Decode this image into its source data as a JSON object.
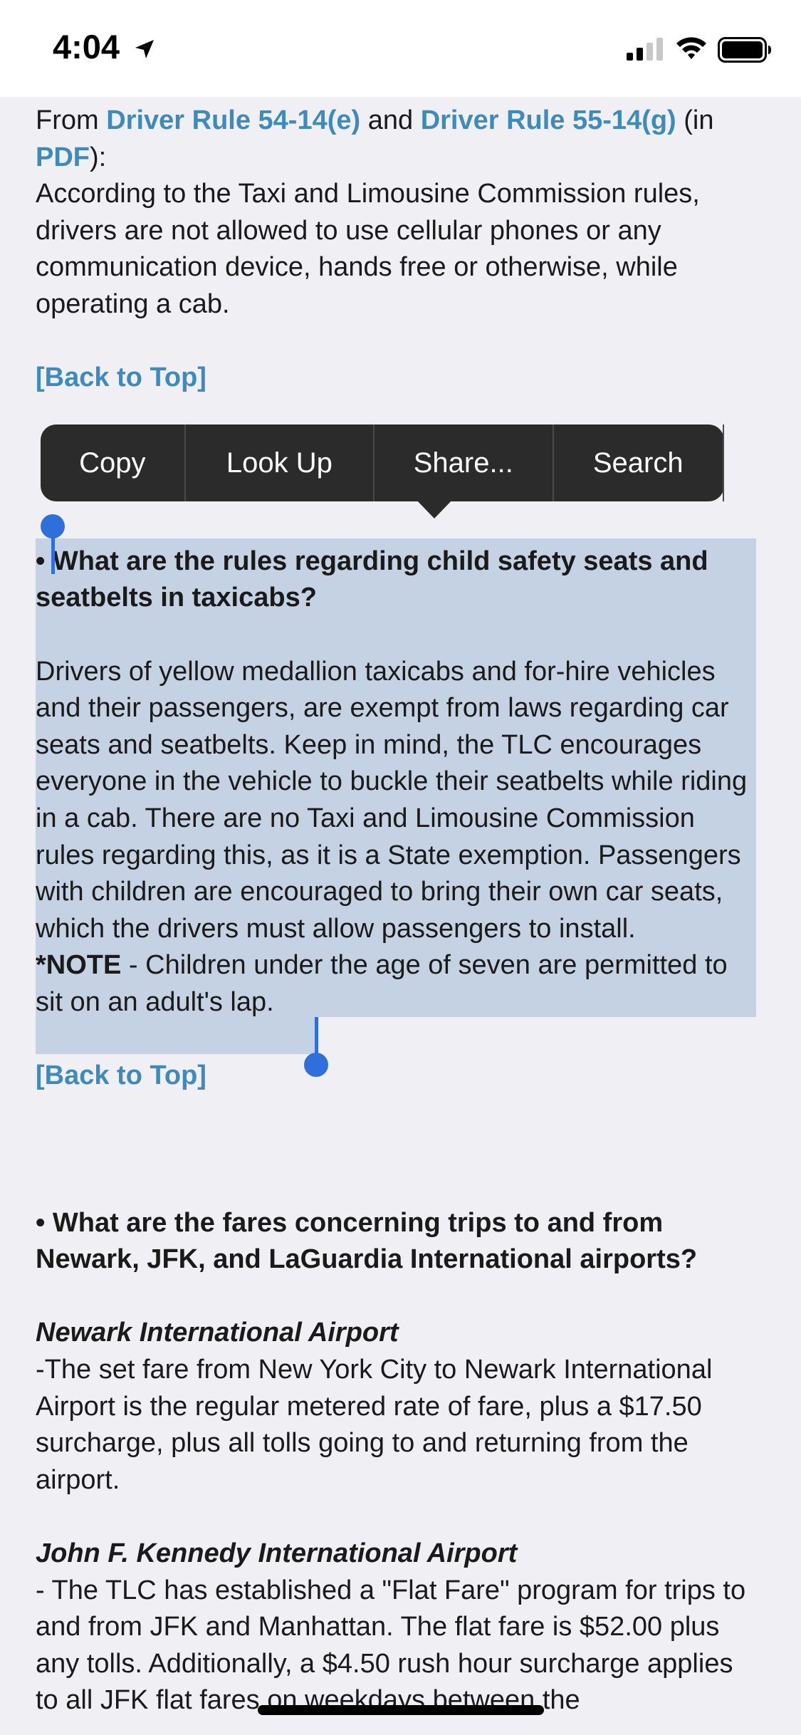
{
  "status": {
    "time": "4:04"
  },
  "icons": {
    "location": "location-arrow-icon",
    "signal": "cellular-signal-icon",
    "wifi": "wifi-icon",
    "battery": "battery-icon"
  },
  "colors": {
    "link": "#3d8bbd",
    "selection": "#c5d2e3",
    "handle": "#2f6fdb",
    "menu_bg": "#2b2b2b"
  },
  "article": {
    "intro": {
      "from": "From ",
      "rule1": "Driver Rule 54-14(e)",
      "and": " and ",
      "rule2": "Driver Rule 55-14(g)",
      "in": " (in ",
      "pdf": "PDF",
      "close": "):",
      "body": "According to the Taxi and Limousine Commission rules, drivers are not allowed to use cellular phones or any communication device, hands free or otherwise, while operating a cab."
    },
    "back_to_top_1": "[Back to Top]",
    "q_child": {
      "bullet": "• ",
      "question": "What are the rules regarding child safety seats and seatbelts in taxicabs?",
      "answer": "Drivers of yellow medallion taxicabs and for-hire vehicles and their passengers, are exempt from laws regarding car seats and seatbelts.  Keep in mind, the TLC encourages everyone in the vehicle to buckle their seatbelts while riding in a cab.  There are no Taxi and Limousine Commission rules regarding this, as it is a State exemption. Passengers with children are encouraged to bring their own car seats, which the drivers must allow passengers to install.",
      "note_label": "*NOTE",
      "note_text": " - Children under the age of seven are permitted to sit on an adult's lap."
    },
    "back_to_top_2": "[Back to Top]",
    "q_fares": {
      "bullet": "• ",
      "question": "What are the fares concerning trips to and from Newark, JFK, and LaGuardia International airports?",
      "newark_title": "Newark International Airport",
      "newark_text": "-The set fare from New York City to Newark International Airport is the regular metered rate of fare, plus a $17.50 surcharge, plus all tolls going to and returning from the airport.",
      "jfk_title": "John F. Kennedy International Airport",
      "jfk_text": "- The TLC has established a \"Flat Fare\" program for trips to and from JFK and Manhattan. The flat fare is $52.00 plus any tolls. Additionally, a $4.50 rush hour surcharge applies to all JFK flat fares on weekdays between the"
    }
  },
  "context_menu": {
    "items": [
      "Copy",
      "Look Up",
      "Share...",
      "Search"
    ]
  }
}
